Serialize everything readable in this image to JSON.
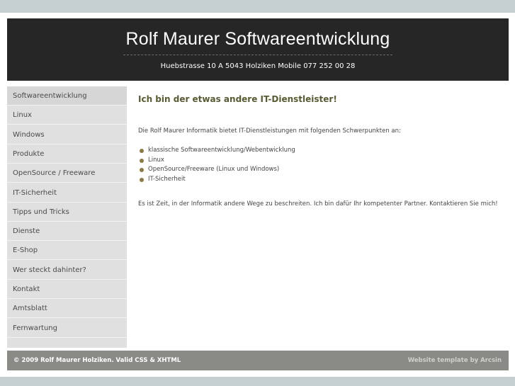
{
  "header": {
    "title": "Rolf Maurer Softwareentwicklung",
    "address": "Huebstrasse 10 A   5043 Holziken   Mobile 077 252 00 28"
  },
  "sidebar": {
    "items": [
      {
        "label": "Softwareentwicklung"
      },
      {
        "label": "Linux"
      },
      {
        "label": "Windows"
      },
      {
        "label": "Produkte"
      },
      {
        "label": "OpenSource / Freeware"
      },
      {
        "label": "IT-Sicherheit"
      },
      {
        "label": "Tipps und Tricks"
      },
      {
        "label": "Dienste"
      },
      {
        "label": "E-Shop"
      },
      {
        "label": "Wer steckt dahinter?"
      },
      {
        "label": "Kontakt"
      },
      {
        "label": "Amtsblatt"
      },
      {
        "label": "Fernwartung"
      }
    ]
  },
  "main": {
    "headline": "Ich bin der etwas andere IT-Dienstleister!",
    "intro": "Die Rolf Maurer Informatik bietet IT-Dienstleistungen mit folgenden Schwerpunkten an:",
    "bullets": [
      "klassische Softwareentwicklung/Webentwicklung",
      "Linux",
      "OpenSource/Freeware (Linux und Windows)",
      "IT-Sicherheit"
    ],
    "closing": "Es ist Zeit, in der Informatik andere Wege zu beschreiten. Ich bin dafür Ihr kompetenter Partner. Kontaktieren Sie mich!"
  },
  "footer": {
    "copyright": "© 2009 Rolf Maurer Holziken. Valid CSS & XHTML",
    "credit": "Website template by Arcsin"
  },
  "colors": {
    "header_bg": "#262626",
    "sidebar_bg": "#e0e0e0",
    "headline": "#5a5a32",
    "bullet": "#8c7a46",
    "footer_bg": "#8a8a86"
  }
}
